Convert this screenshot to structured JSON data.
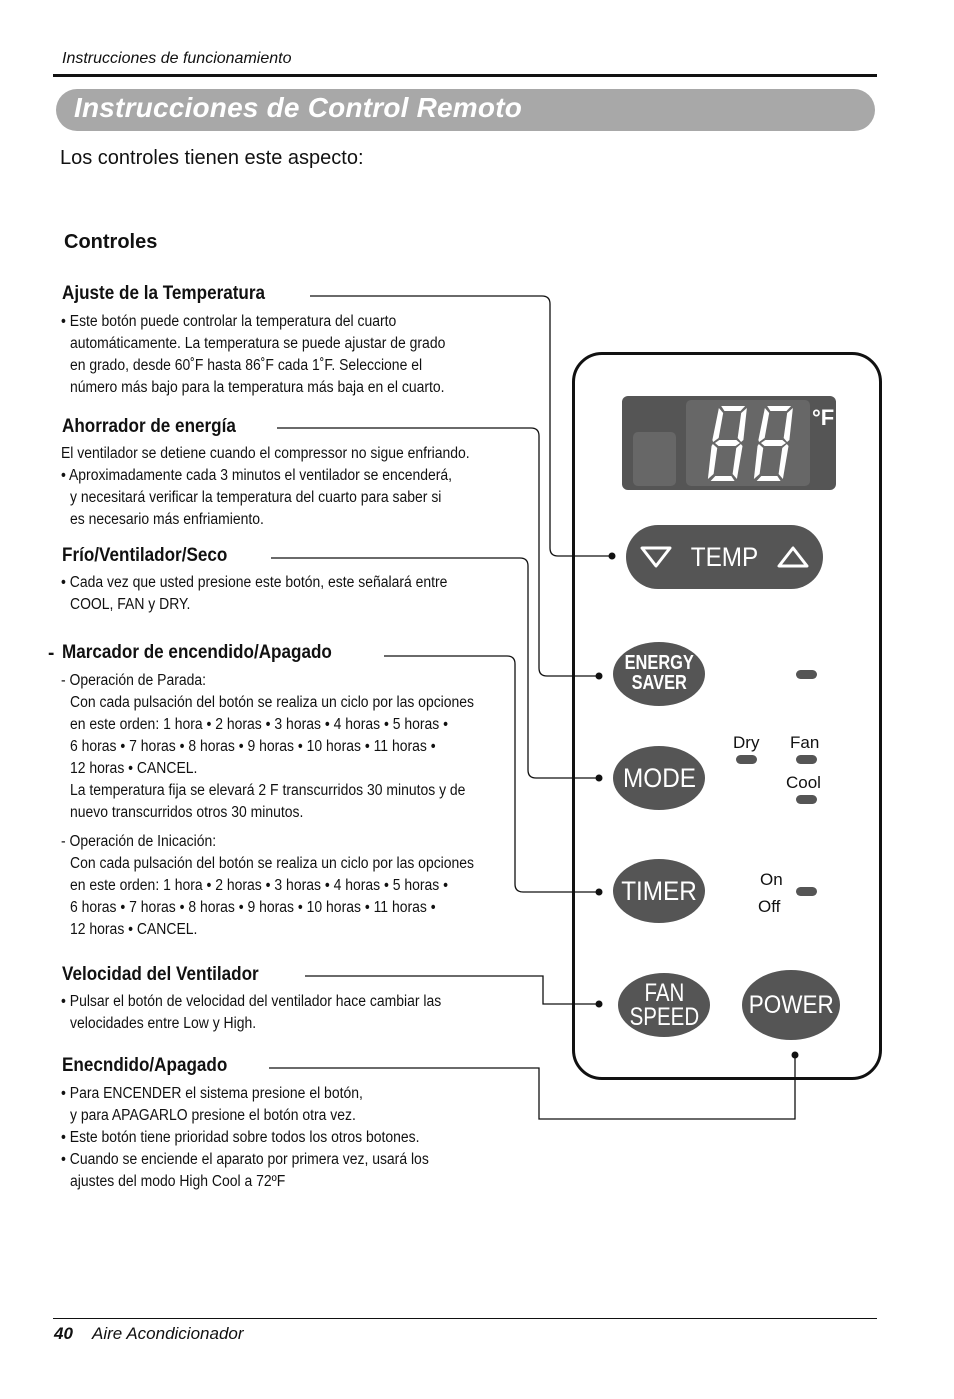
{
  "header": {
    "running_title": "Instrucciones de funcionamiento"
  },
  "banner": {
    "title": "Instrucciones de Control Remoto"
  },
  "intro": "Los controles tienen este aspecto:",
  "controls_heading": "Controles",
  "sections": {
    "temperature": {
      "title": "Ajuste de la Temperatura",
      "lines": [
        "• Este botón puede controlar la temperatura del cuarto",
        "automáticamente. La temperatura se puede ajustar de grado",
        "en grado, desde 60˚F hasta 86˚F cada 1˚F. Seleccione el",
        "número más bajo para la temperatura más baja en el cuarto."
      ]
    },
    "energy_saver": {
      "title": "Ahorrador de energía",
      "lines": [
        "El ventilador se detiene cuando el compressor no sigue enfriando.",
        "• Aproximadamente cada 3 minutos el ventilador se encenderá,",
        "y necesitará verificar la temperatura del cuarto para saber si",
        "es necesario más enfriamiento."
      ]
    },
    "mode": {
      "title": "Frío/Ventilador/Seco",
      "lines": [
        "• Cada vez que usted presione este botón, este señalará entre",
        "COOL, FAN y DRY."
      ]
    },
    "timer": {
      "title": "Marcador de encendido/Apagado",
      "stop_heading": "- Operación de Parada:",
      "stop_lines": [
        "Con cada pulsación del botón se realiza un ciclo por las opciones",
        "en este orden: 1 hora •   2 horas •   3 horas •   4 horas •   5 horas •",
        "6 horas •   7 horas •   8 horas •   9 horas •   10 horas •   11 horas •",
        "12 horas •   CANCEL.",
        "La temperatura fija se elevará  2  F transcurridos 30 minutos y de",
        "nuevo transcurridos otros 30 minutos."
      ],
      "start_heading": "- Operación de Inicación:",
      "start_lines": [
        "Con cada pulsación del botón se realiza un ciclo por las opciones",
        "en este orden: 1 hora •   2 horas •   3 horas •   4 horas •   5 horas •",
        "6 horas •   7 horas •   8 horas •   9 horas •   10 horas •   11 horas •",
        "12 horas •   CANCEL."
      ]
    },
    "fan_speed": {
      "title": "Velocidad del Ventilador",
      "lines": [
        "• Pulsar el botón de velocidad del ventilador hace cambiar las",
        "velocidades entre Low y High."
      ]
    },
    "power": {
      "title": "Enecndido/Apagado",
      "lines": [
        "• Para ENCENDER el sistema presione el botón,",
        "y para APAGARLO presione el botón otra vez.",
        "• Este botón tiene prioridad sobre todos los otros botones.",
        "• Cuando se enciende el aparato por primera vez, usará los",
        "ajustes del modo High Cool a 72ºF"
      ]
    }
  },
  "remote": {
    "display": {
      "digits": "88",
      "unit": "°F"
    },
    "buttons": {
      "temp": {
        "label": "TEMP",
        "down_icon": "triangle-down-outline",
        "up_icon": "triangle-up-outline"
      },
      "energy_saver": {
        "line1": "ENERGY",
        "line2": "SAVER"
      },
      "mode": {
        "label": "MODE"
      },
      "timer": {
        "label": "TIMER"
      },
      "fan_speed": {
        "line1": "FAN",
        "line2": "SPEED"
      },
      "power": {
        "label": "POWER"
      }
    },
    "indicators": {
      "dry": "Dry",
      "fan": "Fan",
      "cool": "Cool",
      "on": "On",
      "off": "Off"
    }
  },
  "colors": {
    "button_fill": "#555555",
    "banner_fill": "#a8a8a8",
    "display_fill": "#555555",
    "display_inner": "#676767"
  },
  "footer": {
    "page_number": "40",
    "title": "Aire Acondicionador"
  }
}
